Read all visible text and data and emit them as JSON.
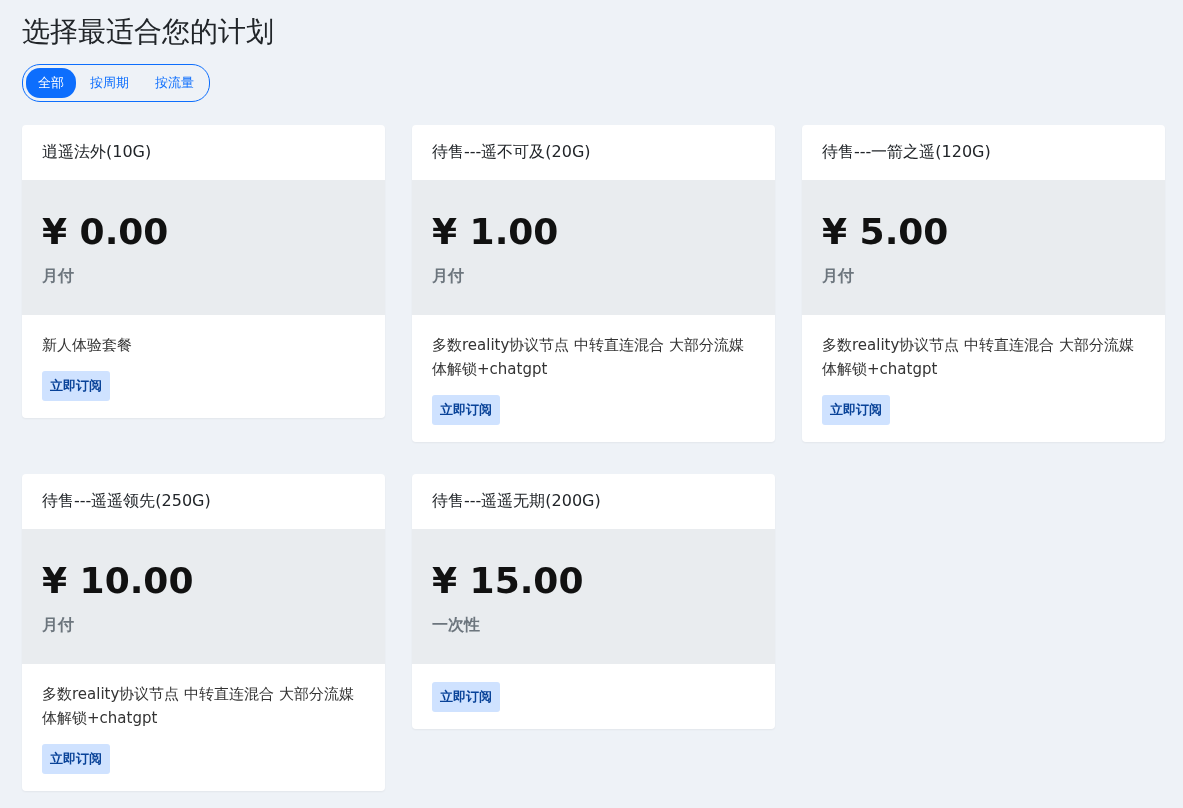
{
  "title": "选择最适合您的计划",
  "tabs": [
    {
      "label": "全部",
      "selected": true
    },
    {
      "label": "按周期",
      "selected": false
    },
    {
      "label": "按流量",
      "selected": false
    }
  ],
  "plans": [
    {
      "name": "逍遥法外(10G)",
      "price": "¥ 0.00",
      "period": "月付",
      "description": "新人体验套餐",
      "button": "立即订阅"
    },
    {
      "name": "待售---遥不可及(20G)",
      "price": "¥ 1.00",
      "period": "月付",
      "description": "多数reality协议节点 中转直连混合 大部分流媒体解锁+chatgpt",
      "button": "立即订阅"
    },
    {
      "name": "待售---一箭之遥(120G)",
      "price": "¥ 5.00",
      "period": "月付",
      "description": "多数reality协议节点 中转直连混合 大部分流媒体解锁+chatgpt",
      "button": "立即订阅"
    },
    {
      "name": "待售---遥遥领先(250G)",
      "price": "¥ 10.00",
      "period": "月付",
      "description": "多数reality协议节点 中转直连混合 大部分流媒体解锁+chatgpt",
      "button": "立即订阅"
    },
    {
      "name": "待售---遥遥无期(200G)",
      "price": "¥ 15.00",
      "period": "一次性",
      "button": "立即订阅"
    }
  ]
}
